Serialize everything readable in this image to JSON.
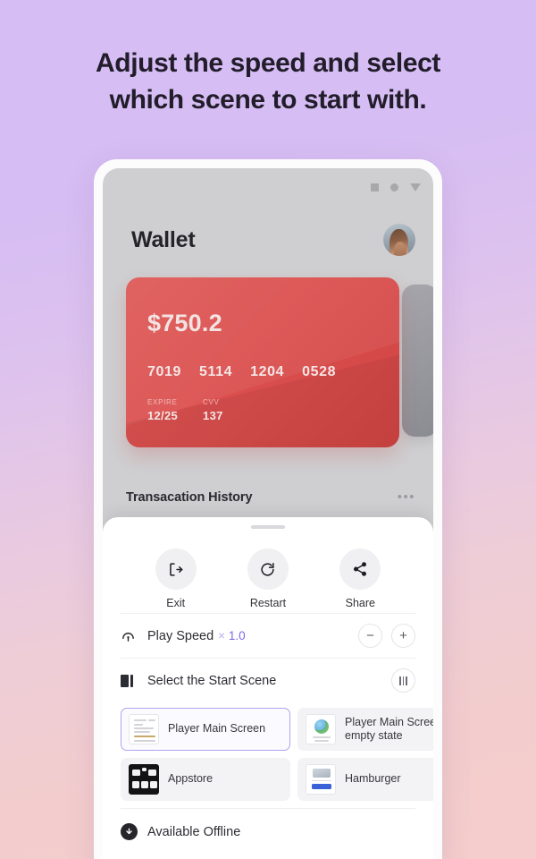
{
  "headline": {
    "line1": "Adjust the speed and select",
    "line2": "which scene to start with."
  },
  "theme": {
    "bg_top": "#d6bdf3",
    "bg_bottom": "#f4cdcc",
    "accent": "#7b68e8",
    "card_red": "#db504f",
    "selected_border": "#b0a4ee"
  },
  "phone": {
    "system_nav": [
      "square-icon",
      "circle-icon",
      "triangle-icon"
    ],
    "wallet": {
      "title": "Wallet",
      "avatar": "user-avatar",
      "card": {
        "amount": "$750.2",
        "number_groups": [
          "7019",
          "5114",
          "1204",
          "0528"
        ],
        "expire_label": "EXPIRE",
        "expire_value": "12/25",
        "cvv_label": "CVV",
        "cvv_value": "137"
      },
      "transactions": {
        "title": "Transacation History",
        "menu": "•••"
      }
    },
    "sheet": {
      "actions": [
        {
          "label": "Exit",
          "icon": "exit-icon"
        },
        {
          "label": "Restart",
          "icon": "restart-icon"
        },
        {
          "label": "Share",
          "icon": "share-icon"
        }
      ],
      "play_speed": {
        "icon": "speedometer-icon",
        "label": "Play Speed",
        "multiplier_symbol": "×",
        "value": "1.0",
        "decrease": "−",
        "increase": "+"
      },
      "start_scene": {
        "icon": "scene-icon",
        "label": "Select the Start Scene",
        "layout_toggle": "columns-icon",
        "scenes": [
          {
            "label": "Player Main Screen",
            "thumb": "document-thumb",
            "selected": true
          },
          {
            "label": "Player Main Screen\nempty state",
            "thumb": "globe-thumb",
            "selected": false
          },
          {
            "label": "Appstore",
            "thumb": "appstore-thumb",
            "selected": false
          },
          {
            "label": "Hamburger",
            "thumb": "hamburger-thumb",
            "selected": false
          }
        ]
      },
      "offline": {
        "icon": "download-icon",
        "label": "Available Offline"
      }
    }
  }
}
